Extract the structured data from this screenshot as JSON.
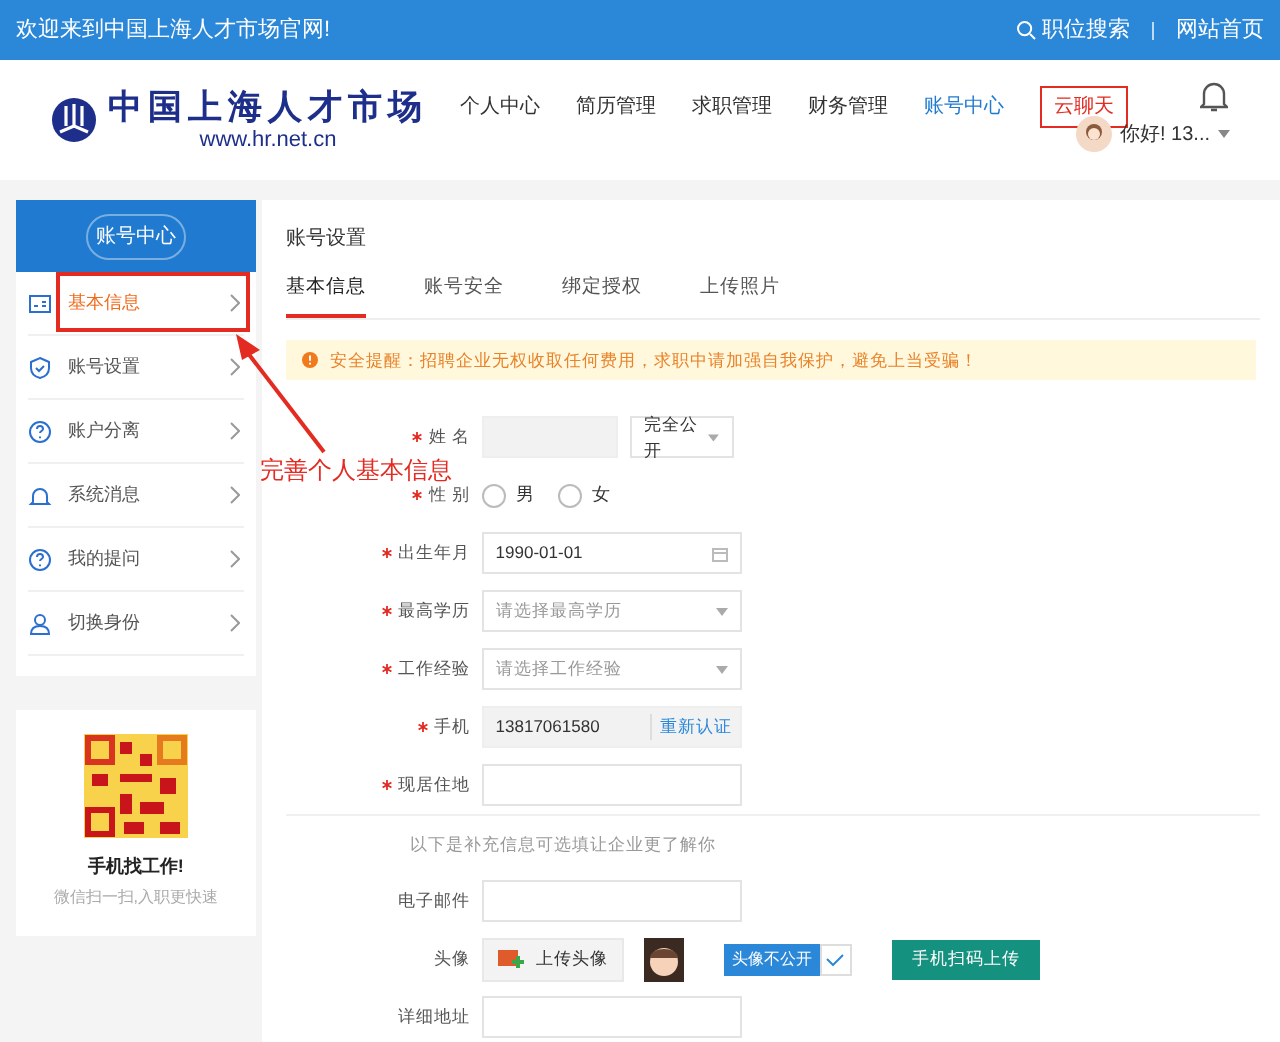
{
  "top_bar": {
    "welcome": "欢迎来到中国上海人才市场官网!",
    "links": [
      "职位搜索",
      "网站首页"
    ]
  },
  "header": {
    "logo_text": "中国上海人才市场",
    "logo_url": "www.hr.net.cn",
    "nav": [
      {
        "label": "个人中心",
        "selected": false
      },
      {
        "label": "简历管理",
        "selected": false
      },
      {
        "label": "求职管理",
        "selected": false
      },
      {
        "label": "财务管理",
        "selected": false
      },
      {
        "label": "账号中心",
        "selected": true
      }
    ],
    "chat_button": "云聊天",
    "greeting": "你好! 13..."
  },
  "sidebar": {
    "title": "账号中心",
    "items": [
      {
        "label": "基本信息",
        "selected": true
      },
      {
        "label": "账号设置",
        "selected": false
      },
      {
        "label": "账户分离",
        "selected": false
      },
      {
        "label": "系统消息",
        "selected": false
      },
      {
        "label": "我的提问",
        "selected": false
      },
      {
        "label": "切换身份",
        "selected": false
      }
    ]
  },
  "qr_card": {
    "title": "手机找工作!",
    "subtitle": "微信扫一扫,入职更快速"
  },
  "main": {
    "section_title": "账号设置",
    "tabs": [
      {
        "label": "基本信息",
        "selected": true
      },
      {
        "label": "账号安全",
        "selected": false
      },
      {
        "label": "绑定授权",
        "selected": false
      },
      {
        "label": "上传照片",
        "selected": false
      }
    ],
    "alert": "安全提醒：招聘企业无权收取任何费用，求职中请加强自我保护，避免上当受骗！",
    "rows": [
      {
        "kind": "name",
        "label": "姓 名",
        "required": true,
        "privacy": "完全公开"
      },
      {
        "kind": "radio",
        "label": "性 别",
        "required": true,
        "options": [
          {
            "label": "男",
            "selected": false
          },
          {
            "label": "女",
            "selected": false
          }
        ]
      },
      {
        "kind": "date",
        "label": "出生年月",
        "required": true,
        "value": "1990-01-01"
      },
      {
        "kind": "select",
        "label": "最高学历",
        "required": true,
        "placeholder": "请选择最高学历"
      },
      {
        "kind": "select",
        "label": "工作经验",
        "required": true,
        "placeholder": "请选择工作经验"
      },
      {
        "kind": "phone",
        "label": "手机",
        "required": true,
        "value": "13817061580",
        "action": "重新认证"
      },
      {
        "kind": "text",
        "label": "现居住地",
        "required": true
      },
      {
        "kind": "note",
        "label": "以下是补充信息可选填让企业更了解你"
      },
      {
        "kind": "text",
        "label": "电子邮件",
        "required": false
      },
      {
        "kind": "avatar",
        "label": "头像",
        "required": false,
        "upload": "上传头像",
        "privacy": "头像不公开",
        "private": true,
        "scan": "手机扫码上传"
      },
      {
        "kind": "text",
        "label": "详细地址",
        "required": false
      }
    ]
  },
  "annotation": {
    "text": "完善个人基本信息"
  }
}
